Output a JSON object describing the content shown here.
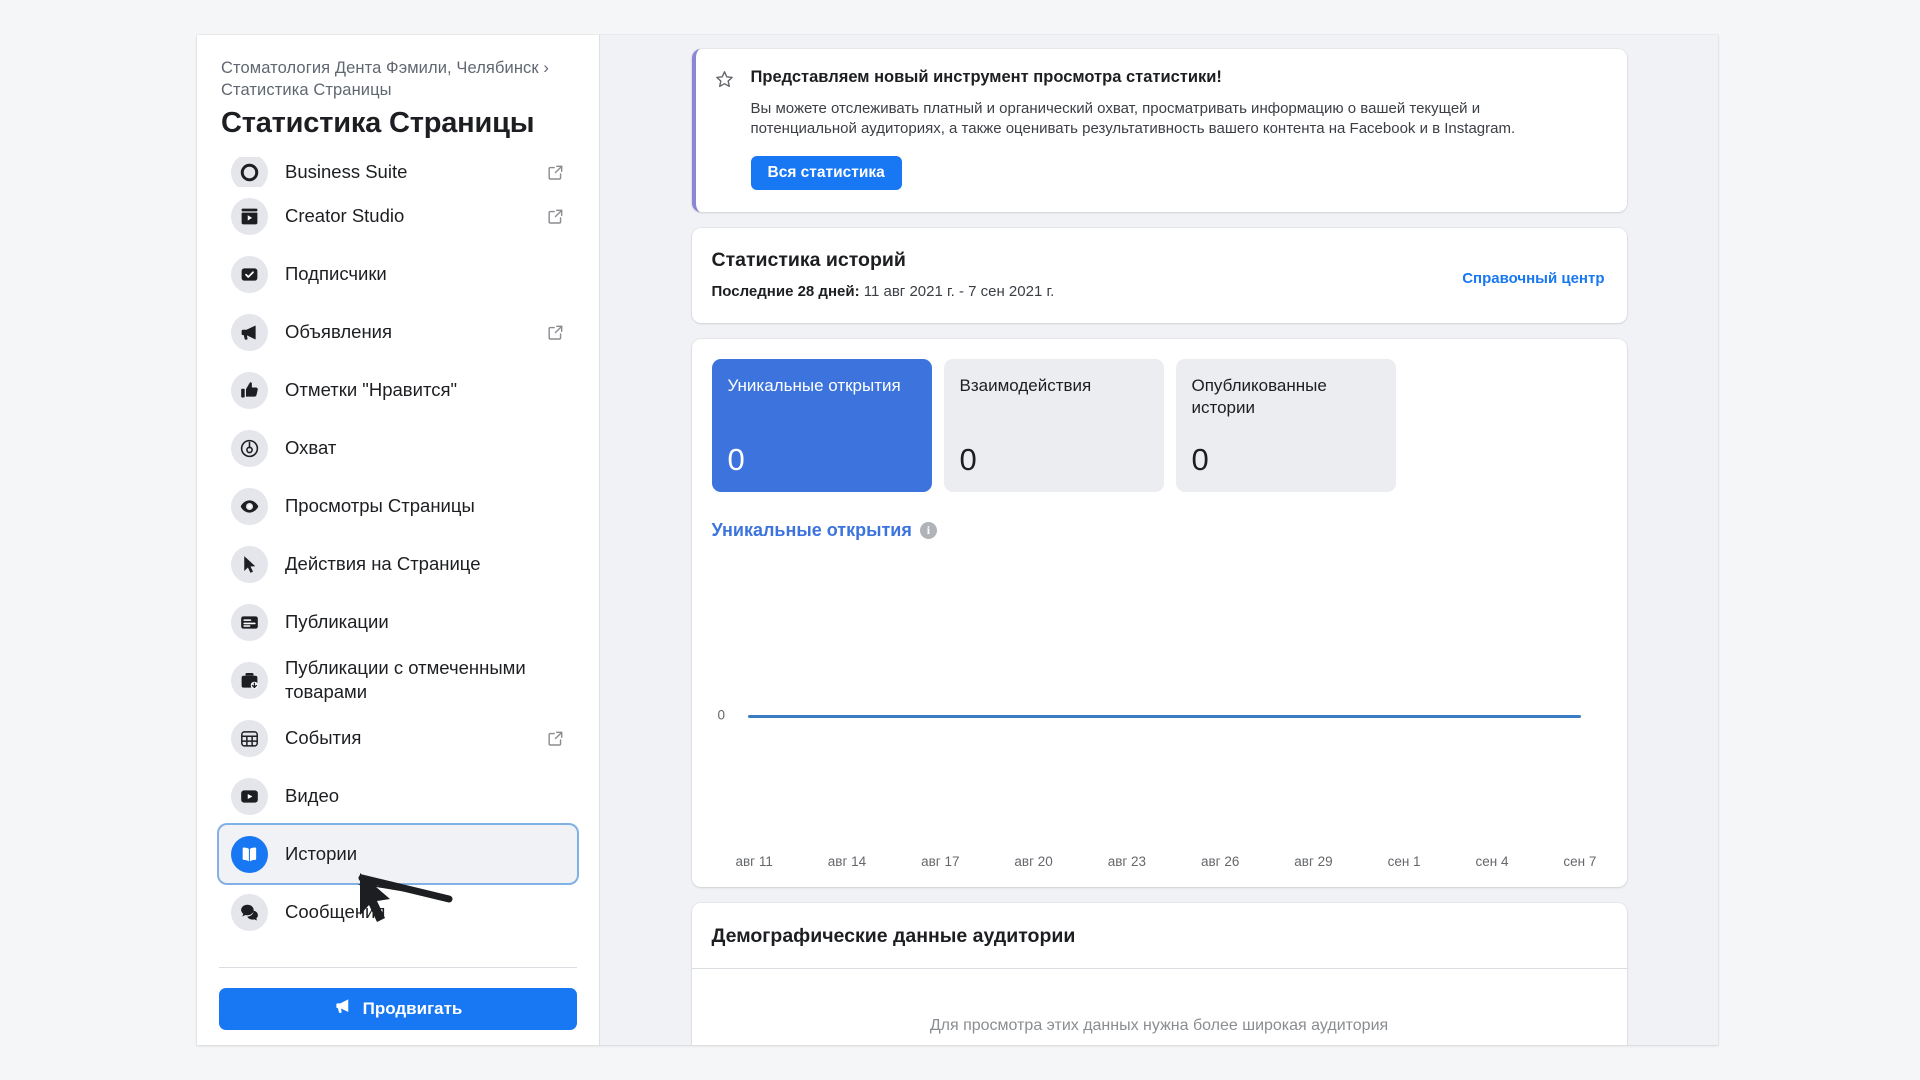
{
  "sidebar": {
    "breadcrumb": "Стоматология Дента Фэмили, Челябинск › Статистика Страницы",
    "page_title": "Статистика Страницы",
    "items": [
      {
        "label": "Business Suite",
        "icon": "business-suite-icon",
        "external": true,
        "selected": false,
        "partial": true
      },
      {
        "label": "Creator Studio",
        "icon": "creator-studio-icon",
        "external": true,
        "selected": false,
        "partial": false
      },
      {
        "label": "Подписчики",
        "icon": "followers-icon",
        "external": false,
        "selected": false,
        "partial": false
      },
      {
        "label": "Объявления",
        "icon": "ads-megaphone-icon",
        "external": true,
        "selected": false,
        "partial": false
      },
      {
        "label": "Отметки \"Нравится\"",
        "icon": "thumbs-up-icon",
        "external": false,
        "selected": false,
        "partial": false
      },
      {
        "label": "Охват",
        "icon": "reach-radar-icon",
        "external": false,
        "selected": false,
        "partial": false
      },
      {
        "label": "Просмотры Страницы",
        "icon": "eye-icon",
        "external": false,
        "selected": false,
        "partial": false
      },
      {
        "label": "Действия на Странице",
        "icon": "cursor-pointer-icon",
        "external": false,
        "selected": false,
        "partial": false
      },
      {
        "label": "Публикации",
        "icon": "posts-icon",
        "external": false,
        "selected": false,
        "partial": false
      },
      {
        "label": "Публикации с отмеченными товарами",
        "icon": "tagged-products-icon",
        "external": false,
        "selected": false,
        "partial": false
      },
      {
        "label": "События",
        "icon": "calendar-grid-icon",
        "external": true,
        "selected": false,
        "partial": false
      },
      {
        "label": "Видео",
        "icon": "video-play-icon",
        "external": false,
        "selected": false,
        "partial": false
      },
      {
        "label": "Истории",
        "icon": "stories-book-icon",
        "external": false,
        "selected": true,
        "partial": false
      },
      {
        "label": "Сообщения",
        "icon": "messages-bubbles-icon",
        "external": false,
        "selected": false,
        "partial": false
      }
    ],
    "promote_button": "Продвигать",
    "promote_icon": "megaphone-icon"
  },
  "banner": {
    "icon": "star-icon",
    "title": "Представляем новый инструмент просмотра статистики!",
    "body": "Вы можете отслеживать платный и органический охват, просматривать информацию о вашей текущей и потенциальной аудиториях, а также оценивать результативность вашего контента на Facebook и в Instagram.",
    "button": "Вся статистика",
    "accent_color": "#8b86d6"
  },
  "stories": {
    "title": "Статистика историй",
    "range_label": "Последние 28 дней:",
    "range_value": "11 авг 2021 г. - 7 сен 2021 г.",
    "help_link": "Справочный центр",
    "tiles": [
      {
        "label": "Уникальные открытия",
        "value": "0",
        "active": true
      },
      {
        "label": "Взаимодействия",
        "value": "0",
        "active": false
      },
      {
        "label": "Опубликованные истории",
        "value": "0",
        "active": false
      }
    ],
    "active_color": "#3c73dd"
  },
  "chart_data": {
    "type": "line",
    "title": "Уникальные открытия",
    "info_icon": "info-icon",
    "xlabel": "",
    "ylabel": "",
    "categories": [
      "авг 11",
      "авг 14",
      "авг 17",
      "авг 20",
      "авг 23",
      "авг 26",
      "авг 29",
      "сен 1",
      "сен 4",
      "сен 7"
    ],
    "tick_labels": [
      "авг 11",
      "авг 14",
      "авг 17",
      "авг 20",
      "авг 23",
      "авг 26",
      "авг 29",
      "сен 1",
      "сен 4",
      "сен 7"
    ],
    "y_ticks": [
      "0"
    ],
    "ylim": [
      0,
      0
    ],
    "series": [
      {
        "name": "Уникальные открытия",
        "values": [
          0,
          0,
          0,
          0,
          0,
          0,
          0,
          0,
          0,
          0
        ],
        "color": "#3b7dc4"
      }
    ],
    "grid": false,
    "legend": "top-left"
  },
  "demographics": {
    "title": "Демографические данные аудитории",
    "empty_message": "Для просмотра этих данных нужна более широкая аудитория"
  }
}
